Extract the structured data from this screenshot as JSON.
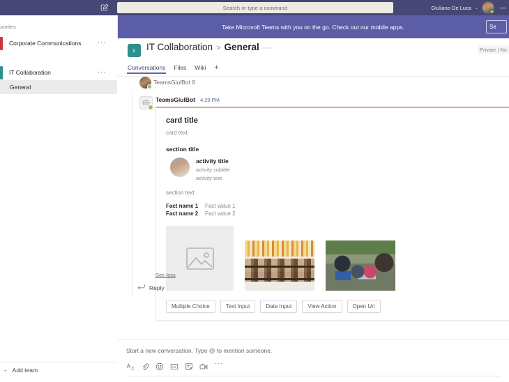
{
  "topbar": {
    "compose_icon": "compose-icon",
    "search_placeholder": "Search or type a command",
    "user_name": "Giuliano De Luca",
    "chevron": "⌄"
  },
  "banner": {
    "text": "Take Microsoft Teams with you on the go. Check out our mobile apps.",
    "button_label": "Se"
  },
  "sidebar": {
    "favorites_label": "Favorites",
    "teams": [
      {
        "name": "Corporate Communications",
        "color": "#d13438",
        "more": "···"
      },
      {
        "name": "IT Collaboration",
        "color": "#2f8f8c",
        "more": "···"
      }
    ],
    "channels": [
      {
        "name": "General",
        "selected": true
      }
    ],
    "add_team": {
      "plus": "+",
      "label": "Add team"
    }
  },
  "channel_header": {
    "team_initial": "c",
    "team_name": "IT Collaboration",
    "separator": ">",
    "channel_name": "General",
    "more": "···",
    "privacy": "Private | No",
    "tabs": [
      {
        "label": "Conversations",
        "active": true
      },
      {
        "label": "Files",
        "active": false
      },
      {
        "label": "Wiki",
        "active": false
      }
    ],
    "tab_add": "+"
  },
  "thread": {
    "preview_author": "TeamsGiulBot 6",
    "message": {
      "author": "TeamsGiulBot",
      "time": "4:29 PM"
    },
    "see_less": "See less",
    "reply": {
      "icon": "reply-arrow-icon",
      "label": "Reply"
    }
  },
  "card": {
    "title": "card title",
    "text": "card text",
    "section_title": "section title",
    "activity": {
      "title": "activity title",
      "subtitle": "activity subtitle",
      "text": "activity text"
    },
    "section_text": "section text",
    "facts": [
      {
        "name": "Fact name 1",
        "value": "Fact value 1"
      },
      {
        "name": "Fact name 2",
        "value": "Fact value 2"
      }
    ],
    "images": [
      {
        "alt": "image-placeholder-icon"
      },
      {
        "alt": "store-shelves-photo"
      },
      {
        "alt": "family-with-laptop-photo"
      }
    ],
    "actions": [
      {
        "label": "Multiple Choice"
      },
      {
        "label": "Text Input"
      },
      {
        "label": "Date Input"
      },
      {
        "label": "View Action"
      },
      {
        "label": "Open Uri"
      }
    ],
    "accent_color": "#e8a0ad"
  },
  "compose": {
    "placeholder": "Start a new conversation. Type @ to mention someone.",
    "icons": [
      "format-icon",
      "attach-icon",
      "emoji-icon",
      "giphy-icon",
      "sticker-icon",
      "meet-now-icon",
      "more-options-icon"
    ]
  },
  "colors": {
    "topbar": "#464775",
    "banner": "#5b5ea6",
    "accent": "#6264a7"
  }
}
